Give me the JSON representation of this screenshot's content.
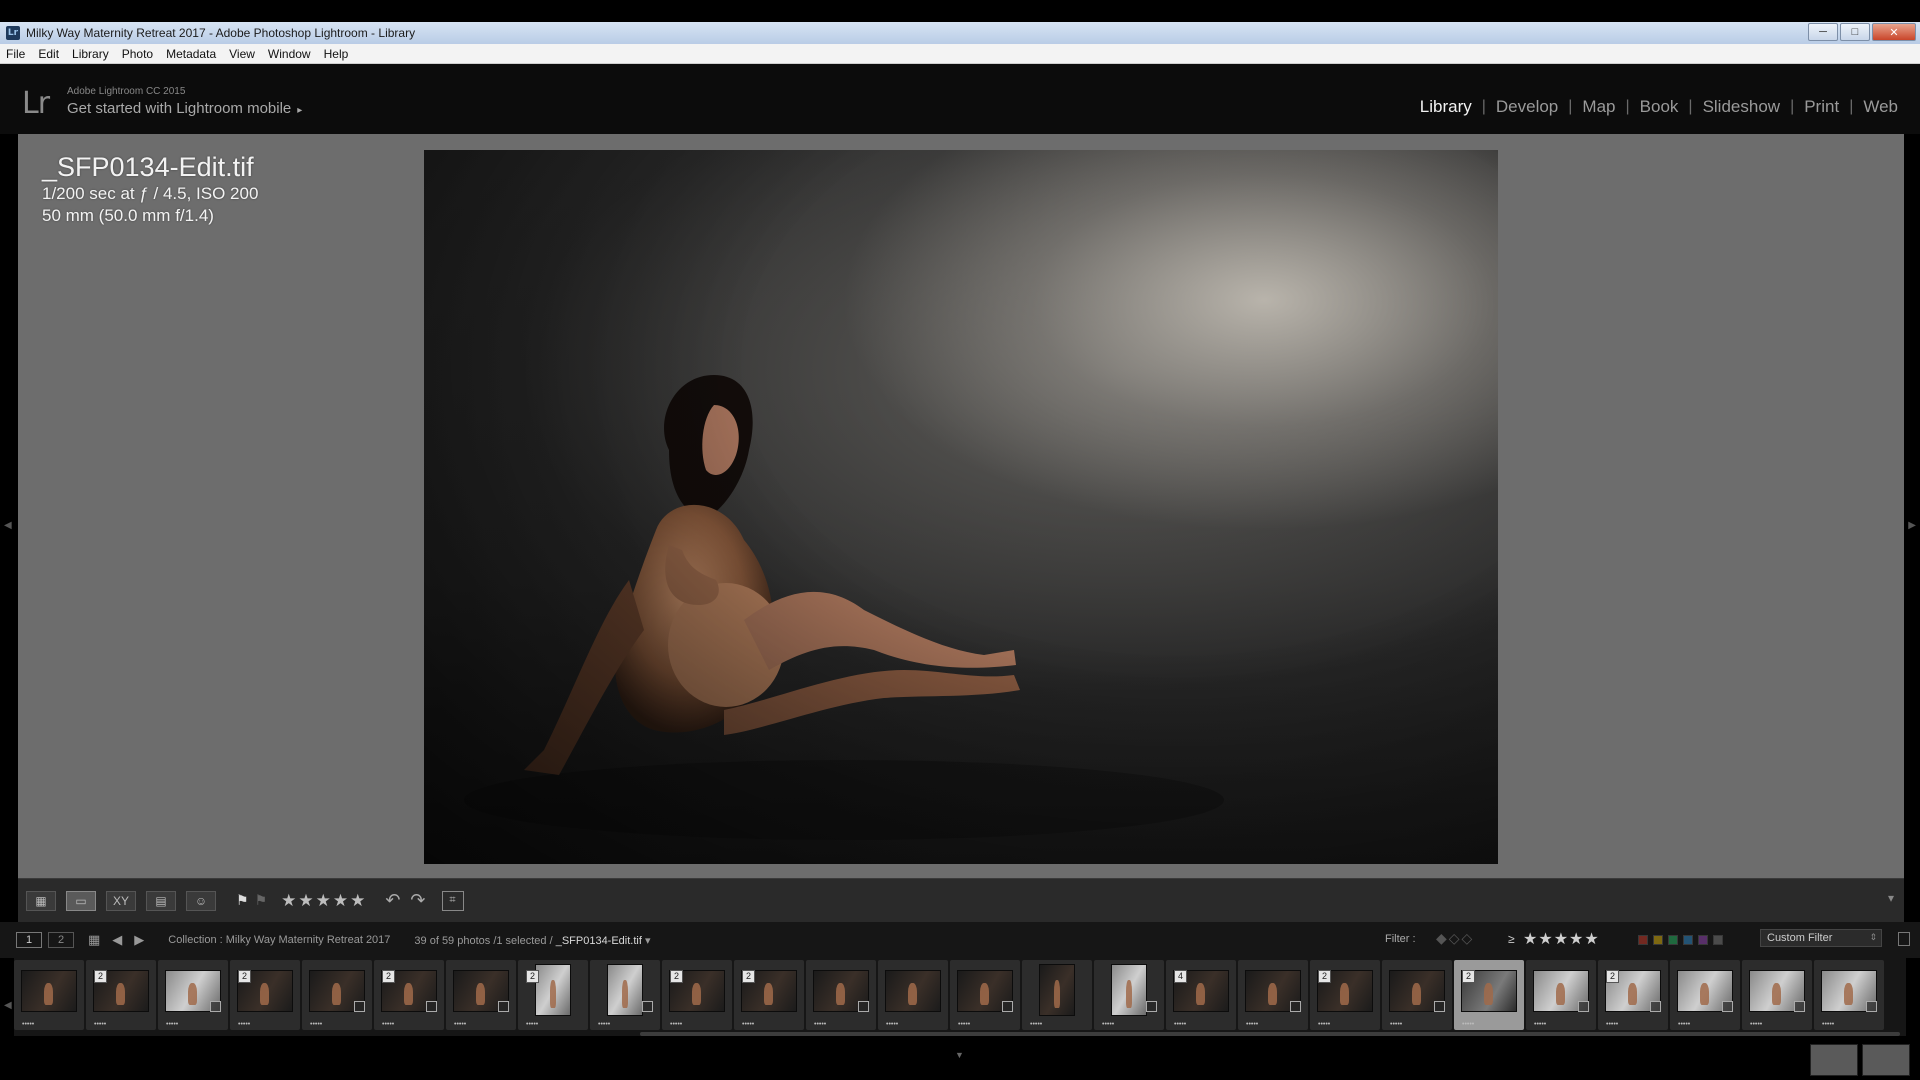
{
  "window": {
    "title": "Milky Way Maternity Retreat 2017 - Adobe Photoshop Lightroom - Library",
    "app_icon": "Lr",
    "controls": [
      "─",
      "□",
      "✕"
    ]
  },
  "menubar": [
    "File",
    "Edit",
    "Library",
    "Photo",
    "Metadata",
    "View",
    "Window",
    "Help"
  ],
  "identity": {
    "logo": "Lr",
    "small": "Adobe Lightroom CC 2015",
    "main": "Get started with Lightroom mobile",
    "arrow": "▸"
  },
  "modules": [
    {
      "label": "Library",
      "active": true
    },
    {
      "label": "Develop",
      "active": false
    },
    {
      "label": "Map",
      "active": false
    },
    {
      "label": "Book",
      "active": false
    },
    {
      "label": "Slideshow",
      "active": false
    },
    {
      "label": "Print",
      "active": false
    },
    {
      "label": "Web",
      "active": false
    }
  ],
  "module_separator": "|",
  "loupe_info": {
    "filename": "_SFP0134-Edit.tif",
    "exposure": "1/200 sec at ƒ / 4.5, ISO 200",
    "lens": "50 mm (50.0 mm f/1.4)"
  },
  "toolbar": {
    "view_icons": [
      "grid-view-icon",
      "loupe-view-icon",
      "compare-view-icon",
      "survey-view-icon",
      "people-view-icon"
    ],
    "view_glyphs": [
      "▦",
      "▭",
      "XY",
      "▤",
      "☺"
    ],
    "flag": "⚑",
    "reject_flag": "⚑",
    "stars": "★★★★★",
    "rotate_left": "↶",
    "rotate_right": "↷",
    "crop_glyph": "⌗",
    "menu_glyph": "▾"
  },
  "filmstrip_header": {
    "monitor1": "1",
    "monitor2": "2",
    "grid_glyph": "▦",
    "prev": "◀",
    "next": "▶",
    "collection": "Collection : Milky Way Maternity Retreat 2017",
    "count": "39 of 59 photos /1 selected /",
    "selected_file": "_SFP0134-Edit.tif",
    "file_dropdown": "▾",
    "filter_label": "Filter :",
    "flag_glyphs": "◆◇◇",
    "rating_op": "≥",
    "filter_stars": "★★★★★",
    "custom_filter": "Custom Filter",
    "custom_dd": "⇕"
  },
  "color_labels": [
    "#c0392b",
    "#d4ac0d",
    "#27ae60",
    "#2e86c1",
    "#8e44ad",
    "#777777"
  ],
  "thumbnails": [
    {
      "badge": "",
      "edit": false,
      "portrait": false,
      "tone": "dark"
    },
    {
      "badge": "2",
      "edit": false,
      "portrait": false,
      "tone": "dark"
    },
    {
      "badge": "",
      "edit": true,
      "portrait": false,
      "tone": "light"
    },
    {
      "badge": "2",
      "edit": false,
      "portrait": false,
      "tone": "dark"
    },
    {
      "badge": "",
      "edit": true,
      "portrait": false,
      "tone": "dark"
    },
    {
      "badge": "2",
      "edit": true,
      "portrait": false,
      "tone": "dark"
    },
    {
      "badge": "",
      "edit": true,
      "portrait": false,
      "tone": "dark"
    },
    {
      "badge": "2",
      "edit": false,
      "portrait": true,
      "tone": "light"
    },
    {
      "badge": "",
      "edit": true,
      "portrait": true,
      "tone": "light"
    },
    {
      "badge": "2",
      "edit": false,
      "portrait": false,
      "tone": "dark"
    },
    {
      "badge": "2",
      "edit": false,
      "portrait": false,
      "tone": "dark"
    },
    {
      "badge": "",
      "edit": true,
      "portrait": false,
      "tone": "dark"
    },
    {
      "badge": "",
      "edit": false,
      "portrait": false,
      "tone": "dark"
    },
    {
      "badge": "",
      "edit": true,
      "portrait": false,
      "tone": "dark"
    },
    {
      "badge": "",
      "edit": false,
      "portrait": true,
      "tone": "dark"
    },
    {
      "badge": "",
      "edit": true,
      "portrait": true,
      "tone": "light"
    },
    {
      "badge": "4",
      "edit": false,
      "portrait": false,
      "tone": "dark"
    },
    {
      "badge": "",
      "edit": true,
      "portrait": false,
      "tone": "dark"
    },
    {
      "badge": "2",
      "edit": false,
      "portrait": false,
      "tone": "dark"
    },
    {
      "badge": "",
      "edit": true,
      "portrait": false,
      "tone": "dark"
    },
    {
      "badge": "2",
      "edit": false,
      "portrait": false,
      "tone": "grey",
      "selected": true
    },
    {
      "badge": "",
      "edit": true,
      "portrait": false,
      "tone": "light"
    },
    {
      "badge": "2",
      "edit": true,
      "portrait": false,
      "tone": "light"
    },
    {
      "badge": "",
      "edit": true,
      "portrait": false,
      "tone": "light"
    },
    {
      "badge": "",
      "edit": true,
      "portrait": false,
      "tone": "light"
    },
    {
      "badge": "",
      "edit": true,
      "portrait": false,
      "tone": "light"
    }
  ],
  "thumb_stars": "•••••",
  "nav_triangles": {
    "up": "▲",
    "down": "▼",
    "left": "◀",
    "right": "▶"
  }
}
